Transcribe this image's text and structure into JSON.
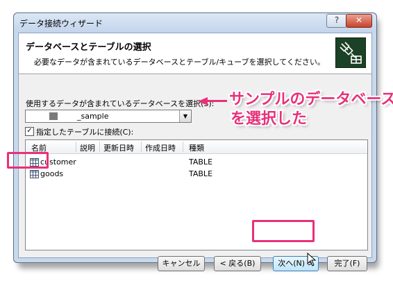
{
  "window": {
    "title": "データ接続ウィザード",
    "help_label": "?",
    "close_label": "✕"
  },
  "header": {
    "title": "データベースとテーブルの選択",
    "description": "必要なデータが含まれているデータベースとテーブル/キューブを選択してください。",
    "icon": "database-plug-icon"
  },
  "database_select": {
    "label": "使用するデータが含まれているデータベースを選択(S):",
    "value": "_sample",
    "arrow": "▼"
  },
  "connect_checkbox": {
    "label": "指定したテーブルに接続(C):",
    "checked": true,
    "mark": "✓"
  },
  "table_list": {
    "columns": [
      "名前",
      "説明",
      "更新日時",
      "作成日時",
      "種類"
    ],
    "rows": [
      {
        "name": "customer",
        "description": "",
        "modified": "",
        "created": "",
        "type": "TABLE"
      },
      {
        "name": "goods",
        "description": "",
        "modified": "",
        "created": "",
        "type": "TABLE"
      }
    ]
  },
  "buttons": {
    "cancel": "キャンセル",
    "back": "< 戻る(B)",
    "next": "次へ(N) >",
    "finish": "完了(F)"
  },
  "annotation": {
    "line1": "サンプルのデータベース",
    "line2": "を選択した",
    "color": "#e8307a"
  }
}
